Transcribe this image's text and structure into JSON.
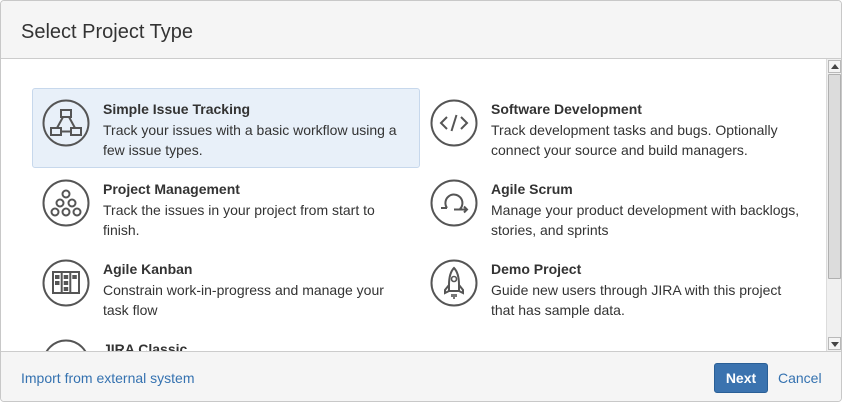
{
  "dialog": {
    "title": "Select Project Type"
  },
  "project_types": [
    {
      "title": "Simple Issue Tracking",
      "description": "Track your issues with a basic workflow using a few issue types.",
      "icon": "workflow-icon",
      "selected": true
    },
    {
      "title": "Software Development",
      "description": "Track development tasks and bugs. Optionally connect your source and build managers.",
      "icon": "code-icon",
      "selected": false
    },
    {
      "title": "Project Management",
      "description": "Track the issues in your project from start to finish.",
      "icon": "hierarchy-icon",
      "selected": false
    },
    {
      "title": "Agile Scrum",
      "description": "Manage your product development with backlogs, stories, and sprints",
      "icon": "sprint-cycle-icon",
      "selected": false
    },
    {
      "title": "Agile Kanban",
      "description": "Constrain work-in-progress and manage your task flow",
      "icon": "kanban-board-icon",
      "selected": false
    },
    {
      "title": "Demo Project",
      "description": "Guide new users through JIRA with this project that has sample data.",
      "icon": "rocket-icon",
      "selected": false
    },
    {
      "title": "JIRA Classic",
      "description": "",
      "icon": "jira-classic-icon",
      "selected": false
    }
  ],
  "footer": {
    "import_label": "Import from external system",
    "next_label": "Next",
    "cancel_label": "Cancel"
  },
  "colors": {
    "accent": "#3b73af",
    "link": "#3572b0",
    "selected_bg": "#e8f0f9",
    "icon_stroke": "#555555"
  }
}
